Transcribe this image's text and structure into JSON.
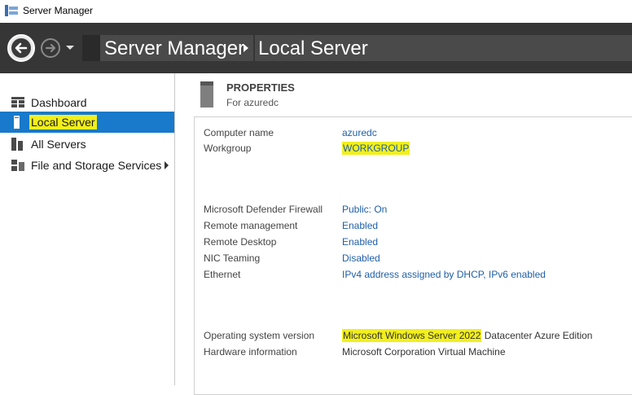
{
  "window": {
    "title": "Server Manager"
  },
  "breadcrumb": {
    "root": "Server Manager",
    "current": "Local Server"
  },
  "sidebar": {
    "items": [
      {
        "label": "Dashboard",
        "icon": "dashboard-icon"
      },
      {
        "label": "Local Server",
        "icon": "server-icon",
        "selected": true
      },
      {
        "label": "All Servers",
        "icon": "servers-icon"
      },
      {
        "label": "File and Storage Services",
        "icon": "storage-icon"
      }
    ]
  },
  "properties": {
    "title": "PROPERTIES",
    "subtitle": "For azuredc",
    "rows": [
      {
        "label": "Computer name",
        "value": "azuredc"
      },
      {
        "label": "Workgroup",
        "value": "WORKGROUP"
      },
      {
        "label": "Microsoft Defender Firewall",
        "value": "Public: On"
      },
      {
        "label": "Remote management",
        "value": "Enabled"
      },
      {
        "label": "Remote Desktop",
        "value": "Enabled"
      },
      {
        "label": "NIC Teaming",
        "value": "Disabled"
      },
      {
        "label": "Ethernet",
        "value": "IPv4 address assigned by DHCP, IPv6 enabled"
      },
      {
        "label": "Operating system version",
        "value_highlight": "Microsoft Windows Server 2022",
        "value_rest": " Datacenter Azure Edition"
      },
      {
        "label": "Hardware information",
        "value": "Microsoft Corporation Virtual Machine"
      }
    ]
  },
  "colors": {
    "nav_bg": "#363636",
    "selected": "#1979ca",
    "link": "#1f5fa8",
    "highlight": "#f2ef1c"
  }
}
